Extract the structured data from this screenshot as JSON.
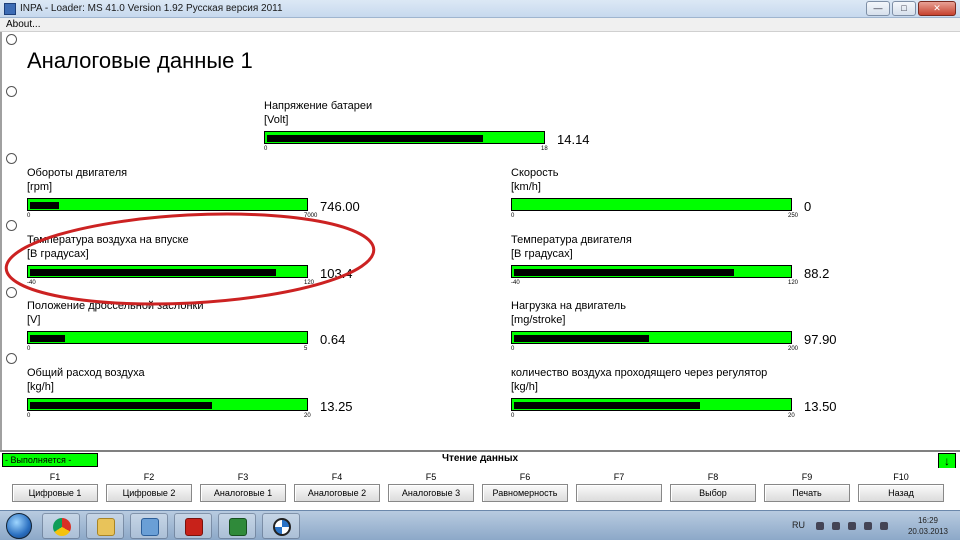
{
  "window": {
    "title": "INPA - Loader:  MS 41.0 Version 1.92  Русская версия 2011",
    "controls": [
      "—",
      "□",
      "✕"
    ]
  },
  "menu": {
    "about": "About..."
  },
  "page": {
    "title": "Аналоговые данные 1"
  },
  "gauges": {
    "battery": {
      "label": "Напряжение  батареи",
      "unit": "[Volt]",
      "min": "0",
      "max": "18",
      "value": "14.14",
      "fraction": 0.786
    },
    "rpm": {
      "label": "Обороты двигателя",
      "unit": "[rpm]",
      "min": "0",
      "max": "7000",
      "value": "746.00",
      "fraction": 0.107
    },
    "speed": {
      "label": "Скорость",
      "unit": "[km/h]",
      "min": "0",
      "max": "250",
      "value": "0",
      "fraction": 0.0
    },
    "intake_temp": {
      "label": "Температура воздуха на впуске",
      "unit": "[В градусах]",
      "min": "-40",
      "max": "120",
      "value": "103.4",
      "fraction": 0.896
    },
    "engine_temp": {
      "label": "Температура двигателя",
      "unit": "[В градусах]",
      "min": "-40",
      "max": "120",
      "value": "88.2",
      "fraction": 0.801
    },
    "throttle": {
      "label": "Положение дроссельной заслонки",
      "unit": "[V]",
      "min": "0",
      "max": "5",
      "value": "0.64",
      "fraction": 0.128
    },
    "load": {
      "label": "Нагрузка  на  двигатель",
      "unit": "[mg/stroke]",
      "min": "0",
      "max": "200",
      "value": "97.90",
      "fraction": 0.49
    },
    "airflow": {
      "label": "Общий расход воздуха",
      "unit": "[kg/h]",
      "min": "0",
      "max": "20",
      "value": "13.25",
      "fraction": 0.663
    },
    "idle_air": {
      "label": "количество воздуха проходящего через регулятор",
      "unit": "[kg/h]",
      "min": "0",
      "max": "20",
      "value": "13.50",
      "fraction": 0.675
    }
  },
  "status": {
    "left": "- Выполняется -",
    "center": "Чтение данных",
    "arrow": "↓"
  },
  "fkeys": [
    {
      "key": "F1",
      "label": "Цифровые 1"
    },
    {
      "key": "F2",
      "label": "Цифровые 2"
    },
    {
      "key": "F3",
      "label": "Аналоговые 1"
    },
    {
      "key": "F4",
      "label": "Аналоговые 2"
    },
    {
      "key": "F5",
      "label": "Аналоговые 3"
    },
    {
      "key": "F6",
      "label": "Равномерность"
    },
    {
      "key": "F7",
      "label": ""
    },
    {
      "key": "F8",
      "label": "Выбор"
    },
    {
      "key": "F9",
      "label": "Печать"
    },
    {
      "key": "F10",
      "label": "Назад"
    }
  ],
  "taskbar": {
    "apps": [
      "chrome-icon",
      "folder-icon",
      "network-icon",
      "pdf-icon",
      "ediabas-icon",
      "bmw-icon"
    ],
    "lang": "RU",
    "time": "16:29",
    "date": "20.03.2013"
  },
  "colors": {
    "gauge_track": "#00ff00",
    "gauge_fill": "#000000",
    "highlight_ellipse": "#cc2222"
  }
}
